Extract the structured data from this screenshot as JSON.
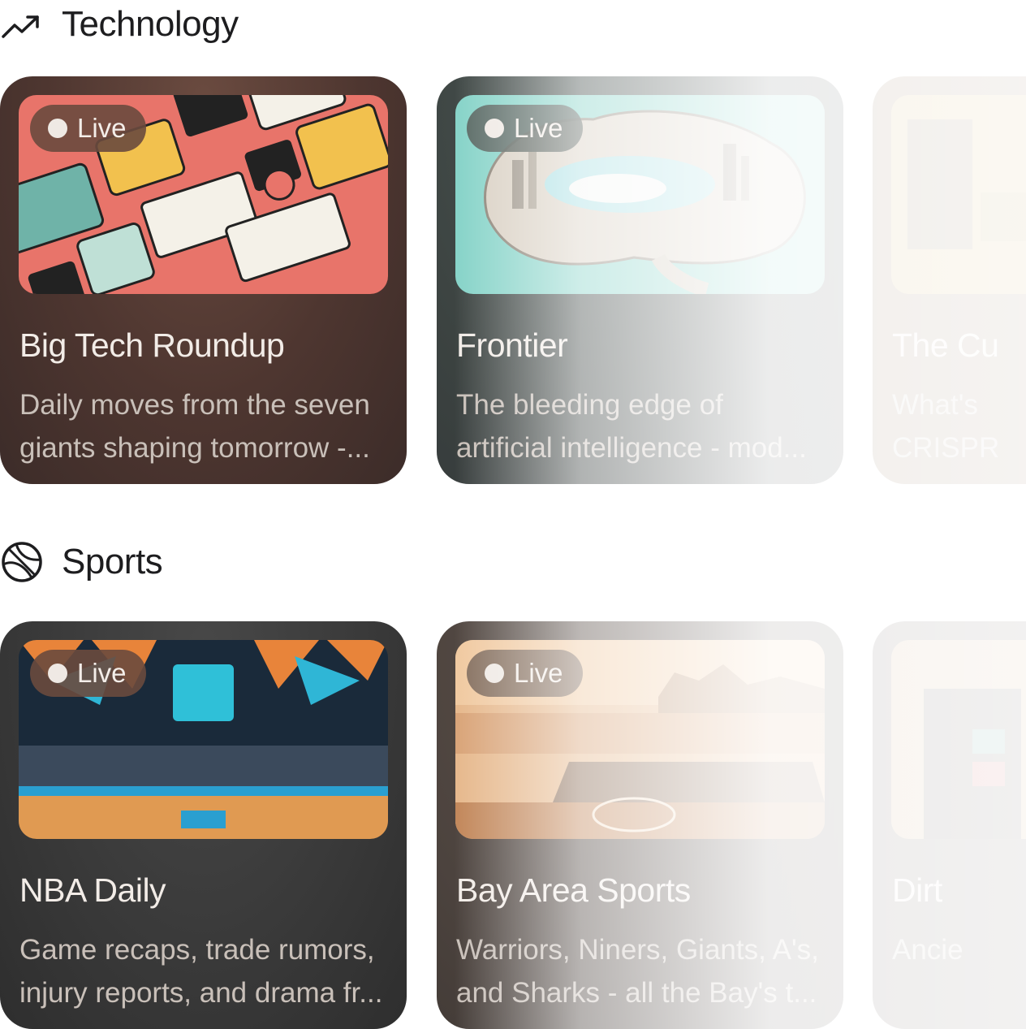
{
  "sections": [
    {
      "title": "Technology",
      "icon": "trending-up-icon",
      "cards": [
        {
          "title": "Big Tech Roundup",
          "desc_line1": "Daily moves from the seven",
          "desc_line2": "giants shaping tomorrow -...",
          "badge": "Live"
        },
        {
          "title": "Frontier",
          "desc_line1": "The bleeding edge of",
          "desc_line2": "artificial intelligence - mod...",
          "badge": "Live"
        },
        {
          "title": "The Cu",
          "desc_line1": "What's",
          "desc_line2": "CRISPR"
        }
      ]
    },
    {
      "title": "Sports",
      "icon": "basketball-icon",
      "cards": [
        {
          "title": "NBA Daily",
          "desc_line1": "Game recaps, trade rumors,",
          "desc_line2": "injury reports, and drama fr...",
          "badge": "Live"
        },
        {
          "title": "Bay Area Sports",
          "desc_line1": "Warriors, Niners, Giants, A's,",
          "desc_line2": "and Sharks - all the Bay's t...",
          "badge": "Live"
        },
        {
          "title": "Dirt",
          "desc_line1": "Ancie",
          "desc_line2": ""
        }
      ]
    }
  ],
  "colors": {
    "card_big_tech": "#5a3e36",
    "card_frontier": "#3e4644",
    "card_nba": "#3a3a3a",
    "card_bay_area": "#4e4540",
    "page_background": "#ffffff"
  }
}
